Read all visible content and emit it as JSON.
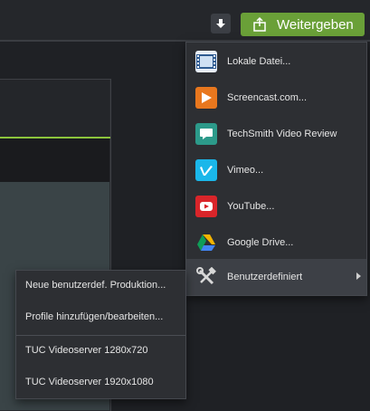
{
  "toolbar": {
    "download_icon": "download-icon",
    "share_label": "Weitergeben",
    "share_icon": "upload-icon",
    "accent_color": "#6aa038"
  },
  "share_menu": {
    "items": [
      {
        "label": "Lokale Datei...",
        "icon": "film-strip-icon",
        "color": "#2f5b91"
      },
      {
        "label": "Screencast.com...",
        "icon": "screencast-icon",
        "color": "#e8771e"
      },
      {
        "label": "TechSmith Video Review",
        "icon": "speech-bubble-icon",
        "color": "#2c9a8a"
      },
      {
        "label": "Vimeo...",
        "icon": "vimeo-icon",
        "color": "#1ab7ea"
      },
      {
        "label": "YouTube...",
        "icon": "youtube-icon",
        "color": "#d9252a"
      },
      {
        "label": "Google Drive...",
        "icon": "google-drive-icon",
        "color": "#f4b400"
      },
      {
        "label": "Benutzerdefiniert",
        "icon": "wrench-hammer-icon",
        "color": "#cfcfcf"
      }
    ]
  },
  "custom_submenu": {
    "items": [
      {
        "label": "Neue benutzerdef. Produktion..."
      },
      {
        "label": "Profile hinzufügen/bearbeiten..."
      },
      {
        "label": "TUC Videoserver 1280x720"
      },
      {
        "label": "TUC Videoserver 1920x1080"
      }
    ]
  }
}
